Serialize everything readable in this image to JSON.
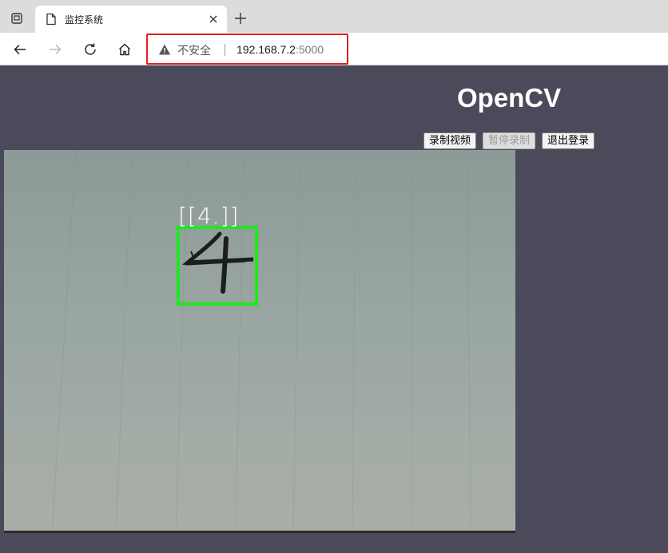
{
  "browser": {
    "tab": {
      "title": "监控系统"
    },
    "address_bar": {
      "security_text": "不安全",
      "host": "192.168.7.2",
      "port": ":5000"
    }
  },
  "page": {
    "title": "OpenCV",
    "buttons": {
      "record": "录制视频",
      "pause": "暂停录制",
      "logout": "退出登录"
    },
    "video": {
      "detection_label": "[[4.]]",
      "detected_digit": "4"
    }
  },
  "colors": {
    "page_background": "#4a4a5a",
    "detection_box": "#1ee81e",
    "address_highlight": "#e02020"
  }
}
